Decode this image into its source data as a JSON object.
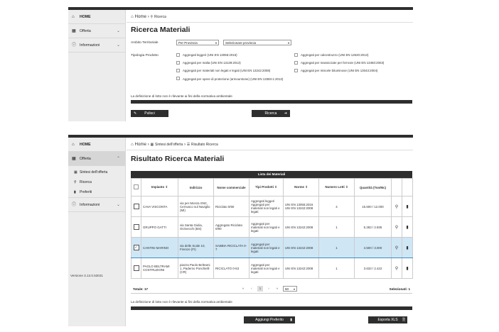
{
  "top": {
    "sidebar": [
      {
        "label": "HOME"
      },
      {
        "label": "Offerta"
      },
      {
        "label": "Informazioni"
      }
    ],
    "breadcrumb": {
      "home": "Home",
      "current": "Ricerca"
    },
    "title": "Ricerca Materiali",
    "ambito_label": "Ambito Territoriale",
    "ambito_select": "Per Provincia",
    "provincia_select": "Selezionare provincia",
    "tipologia_label": "Tipologia Prodotto",
    "checkboxes_left": [
      "Aggregati leggeri (UNI EN 13055:2016)",
      "Aggregati per malta (UNI EN 13139:2013)",
      "Aggregati per materiali non legati e legati (UNI EN 13242:2008)",
      "Aggregati per opere di protezione (armourstone) (UNI EN 13383-1:2013)"
    ],
    "checkboxes_right": [
      "Aggregati per calcestruzzo (UNI EN 12620:2013)",
      "Aggregati per massicciate per ferrovie (UNI EN 13450:2003)",
      "Aggregati per miscele bituminose (UNI EN 13043:2004)"
    ],
    "note": "La definizione di lotto non è rilevante ai fini della normativa ambientale",
    "btn_pulisci": "Pulisci",
    "btn_ricerca": "Ricerca"
  },
  "bottom": {
    "sidebar": {
      "home": "HOME",
      "offerta": "Offerta",
      "sub": [
        "Sintesi dell'offerta",
        "Ricerca",
        "Preferiti"
      ],
      "informazioni": "Informazioni",
      "version": "Versione 3.13.0.53031"
    },
    "breadcrumb": {
      "home": "Home",
      "mid": "Sintesi dell'offerta",
      "current": "Risultato Ricerca"
    },
    "title": "Risultato Ricerca Materiali",
    "table_title": "Lista dei Materiali",
    "columns": [
      "",
      "Impianto ⇕",
      "Indirizzo",
      "Nome commerciale",
      "Tipi Prodotti ⇕",
      "Norme ⇕",
      "Numero Lotti ⇕",
      "Quantità (Ton/Mc)",
      "",
      ""
    ],
    "rows": [
      {
        "impianto": "CAVA VISCONTA",
        "indirizzo": "via per Monza SNC, Cernusco sul Naviglio (MI)",
        "nome": "Riciclato 0/60",
        "tipi": "Aggregati leggeri Aggregati per materiali non legati e legati",
        "norme": "UNI EN 13055:2016 UNI EN 13242:2008",
        "lotti": "4",
        "quantita": "15.600 / 12.000",
        "selected": false
      },
      {
        "impianto": "GRUPPO GATTI",
        "indirizzo": "via Santa Giulia, Orzivecchi (BS)",
        "nome": "Aggregato Riciclato 0/90",
        "tipi": "Aggregati per materiali non legati e legati",
        "norme": "UNI EN 13242:2008",
        "lotti": "1",
        "quantita": "5.283 / 2.935",
        "selected": false
      },
      {
        "impianto": "CANTINI MARINO",
        "indirizzo": "via delle Scale 10, Firenze (FI)",
        "nome": "SABBIA RICICLATA 0-7",
        "tipi": "Aggregati per materiali non legati e legati",
        "norme": "UNI EN 13242:2008",
        "lotti": "1",
        "quantita": "4.500 / 3.000",
        "selected": true
      },
      {
        "impianto": "PAGLO BELTRAMI COSTRUZIONI",
        "indirizzo": "piazza Paolo Beltrami 1, Paderno Ponchielli (CR)",
        "nome": "RICICLATO 0-63",
        "tipi": "Aggregati per materiali non legati e legati",
        "norme": "UNI EN 13242:2008",
        "lotti": "1",
        "quantita": "3.633 / 2.422",
        "selected": false
      }
    ],
    "totale": "Totale: 17",
    "pager": [
      "«",
      "‹",
      "1",
      "›",
      "»"
    ],
    "page_size": "50",
    "selezionati": "Selezionati: 1",
    "note": "La definizione di lotto non è rilevante ai fini della normativa ambientale",
    "btn_preferito": "Aggiungi Preferito",
    "btn_esporta": "Esporta XLS"
  }
}
